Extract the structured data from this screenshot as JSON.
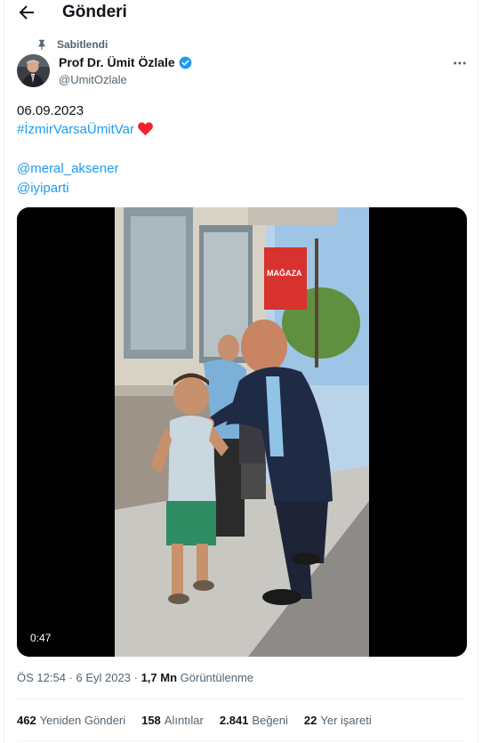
{
  "header": {
    "title": "Gönderi"
  },
  "post": {
    "pinned_label": "Sabitlendi",
    "author": {
      "name": "Prof Dr. Ümit Özlale",
      "handle": "@UmitOzlale"
    },
    "text": {
      "date": "06.09.2023",
      "hashtag": "#İzmirVarsaÜmitVar",
      "mention1": "@meral_aksener",
      "mention2": "@iyiparti"
    },
    "media": {
      "duration": "0:47",
      "shop_sign": "MAĞAZA"
    },
    "meta": {
      "time": "ÖS 12:54",
      "sep1": "·",
      "date": "6 Eyl 2023",
      "sep2": "·",
      "views_count": "1,7 Mn",
      "views_label": "Görüntülenme"
    },
    "stats": {
      "reposts_count": "462",
      "reposts_label": "Yeniden Gönderi",
      "quotes_count": "158",
      "quotes_label": "Alıntılar",
      "likes_count": "2.841",
      "likes_label": "Beğeni",
      "bookmarks_count": "22",
      "bookmarks_label": "Yer işareti"
    }
  },
  "colors": {
    "accent": "#1d9bf0",
    "text": "#0f1419",
    "secondary": "#536471",
    "heart": "#f4212e"
  }
}
